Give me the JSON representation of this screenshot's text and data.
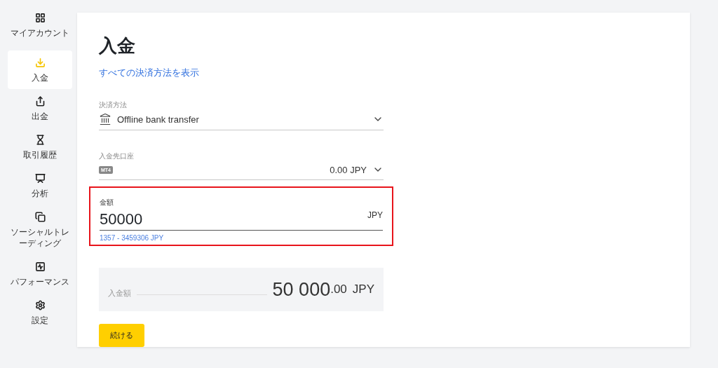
{
  "sidebar": {
    "items": [
      {
        "label": "マイアカウント",
        "selected": false
      },
      {
        "label": "入金",
        "selected": true
      },
      {
        "label": "出金",
        "selected": false
      },
      {
        "label": "取引履歴",
        "selected": false
      },
      {
        "label": "分析",
        "selected": false
      },
      {
        "label": "ソーシャルトレーディング",
        "selected": false
      },
      {
        "label": "パフォーマンス",
        "selected": false
      },
      {
        "label": "設定",
        "selected": false
      }
    ]
  },
  "page": {
    "title": "入金",
    "link": "すべての決済方法を表示"
  },
  "payment_method": {
    "label": "決済方法",
    "value": "Offline bank transfer"
  },
  "account": {
    "label": "入金先口座",
    "badge": "MT4",
    "value": "0.00 JPY"
  },
  "amount": {
    "label": "金額",
    "value": "50000",
    "currency": "JPY",
    "hint": "1357 - 3459306 JPY",
    "highlighted": true
  },
  "summary": {
    "label": "入金額",
    "integer": "50 000",
    "decimals": ".00",
    "currency": "JPY"
  },
  "continue_button": "続ける"
}
